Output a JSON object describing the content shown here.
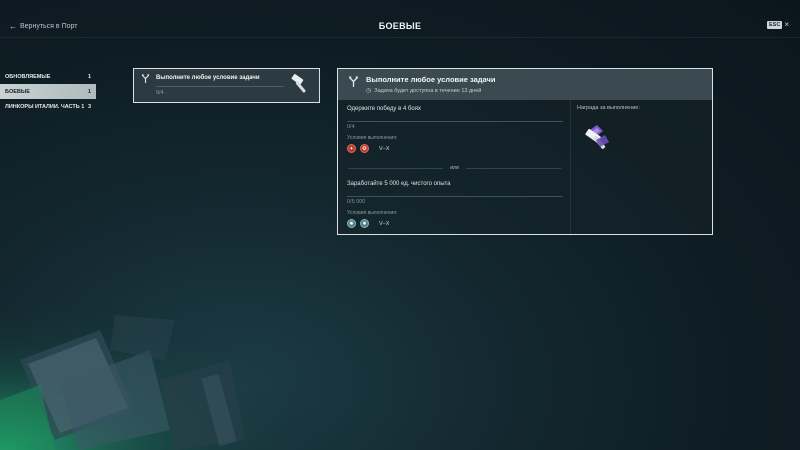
{
  "header": {
    "back_label": "Вернуться в Порт",
    "title": "БОЕВЫЕ",
    "esc_label": "ESC",
    "close_glyph": "×"
  },
  "sidebar": {
    "items": [
      {
        "label": "ОБНОВЛЯЕМЫЕ",
        "count": "1",
        "active": false
      },
      {
        "label": "БОЕВЫЕ",
        "count": "1",
        "active": true
      },
      {
        "label": "ЛИНКОРЫ ИТАЛИИ. ЧАСТЬ 1",
        "count": "3",
        "active": false
      }
    ]
  },
  "task_card": {
    "icon": "branch-icon",
    "title": "Выполните любое условие задачи",
    "progress": "0/4",
    "reward_icon": "hammer-icon"
  },
  "detail": {
    "title": "Выполните любое условие задачи",
    "availability": "Задача будет доступна в течение 13 дней",
    "conditions": [
      {
        "title": "Одержите победу в 4 боях",
        "progress": "0/4",
        "conditions_label": "Условия выполнения:",
        "tiers": "V–X",
        "nation_colors": [
          "#b43a2c",
          "#b43a2c"
        ]
      },
      {
        "title": "Заработайте 5 000 ед. чистого опыта",
        "progress": "0/5 000",
        "conditions_label": "Условия выполнения:",
        "tiers": "V–X",
        "nation_colors": [
          "#4d7c86",
          "#4d7c86"
        ]
      }
    ],
    "or_label": "или",
    "reward_label": "Награда за выполнение:",
    "reward_icon": "hammer-reward-icon"
  },
  "colors": {
    "active_tab_bg": "#c9d1d4",
    "panel_border": "#d9e1e3",
    "reward_purple": "#7b5cc6"
  }
}
